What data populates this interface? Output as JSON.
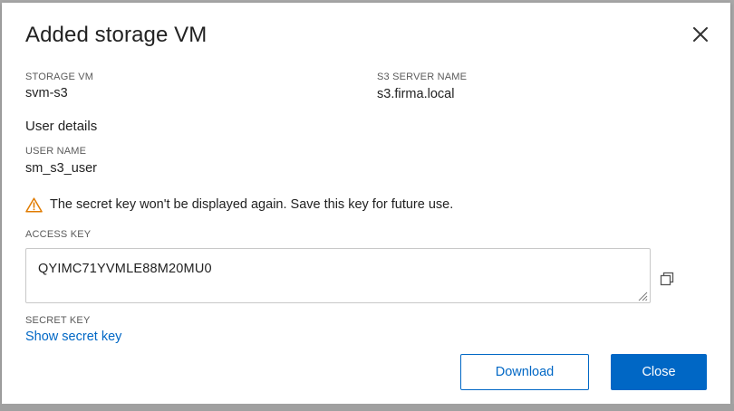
{
  "dialog": {
    "title": "Added storage VM",
    "close_icon": "close-icon"
  },
  "storage_vm": {
    "label": "STORAGE VM",
    "value": "svm-s3"
  },
  "s3_server": {
    "label": "S3 SERVER NAME",
    "value": "s3.firma.local"
  },
  "user_details": {
    "heading": "User details",
    "user_name_label": "USER NAME",
    "user_name_value": "sm_s3_user"
  },
  "warning": {
    "icon": "warning-triangle-icon",
    "text": "The secret key won't be displayed again. Save this key for future use.",
    "color": "#e07b00"
  },
  "access_key": {
    "label": "ACCESS KEY",
    "value": "QYIMC71YVMLE88M20MU0",
    "copy_icon": "copy-icon"
  },
  "secret_key": {
    "label": "SECRET KEY",
    "link": "Show secret key"
  },
  "buttons": {
    "download": "Download",
    "close": "Close"
  },
  "colors": {
    "accent": "#0067c5",
    "text": "#222222",
    "muted": "#5a5a5a"
  }
}
